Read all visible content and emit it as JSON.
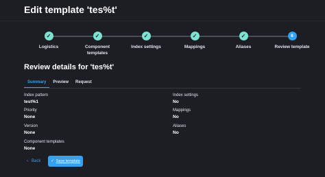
{
  "page": {
    "title": "Edit template 'tes%t'"
  },
  "steps": [
    {
      "label": "Logistics",
      "status": "complete",
      "icon": "check-icon"
    },
    {
      "label": "Component templates",
      "status": "complete",
      "icon": "check-icon"
    },
    {
      "label": "Index settings",
      "status": "complete",
      "icon": "check-icon"
    },
    {
      "label": "Mappings",
      "status": "complete",
      "icon": "check-icon"
    },
    {
      "label": "Aliases",
      "status": "complete",
      "icon": "check-icon"
    },
    {
      "label": "Review template",
      "status": "current",
      "number": "6"
    }
  ],
  "review": {
    "title": "Review details for 'tes%t'",
    "tabs": [
      "Summary",
      "Preview",
      "Request"
    ],
    "active_tab": "Summary",
    "left": [
      {
        "label": "Index pattern",
        "value": "test%1"
      },
      {
        "label": "Priority",
        "value": "None"
      },
      {
        "label": "Version",
        "value": "None"
      },
      {
        "label": "Component templates",
        "value": "None"
      }
    ],
    "right": [
      {
        "label": "Index settings",
        "value": "No"
      },
      {
        "label": "Mappings",
        "value": "No"
      },
      {
        "label": "Aliases",
        "value": "No"
      }
    ]
  },
  "actions": {
    "back_label": "Back",
    "save_label": "Save template"
  },
  "colors": {
    "accent": "#36a2ef",
    "complete": "#7de2d1",
    "background": "#1d1e24"
  }
}
